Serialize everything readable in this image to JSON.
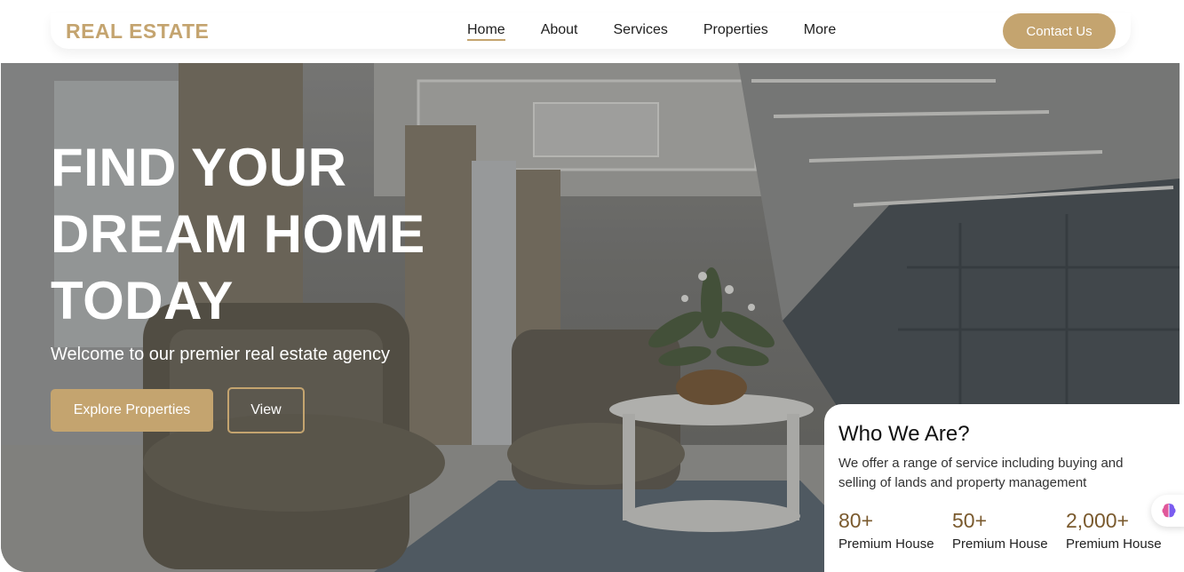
{
  "brand": {
    "logo": "REAL ESTATE",
    "accent_color": "#c4a46f"
  },
  "nav": {
    "links": [
      "Home",
      "About",
      "Services",
      "Properties",
      "More"
    ],
    "active": "Home",
    "contact_label": "Contact Us"
  },
  "hero": {
    "title_lines": [
      "FIND YOUR",
      "DREAM HOME",
      "TODAY"
    ],
    "subtitle": "Welcome to our premier real estate agency",
    "primary_button": "Explore Properties",
    "secondary_button": "View"
  },
  "about_card": {
    "title": "Who We Are?",
    "text": "We offer a range of service including buying and selling of lands and property management",
    "stats": [
      {
        "value": "80+",
        "label": "Premium House"
      },
      {
        "value": "50+",
        "label": "Premium House"
      },
      {
        "value": "2,000+",
        "label": "Premium House"
      }
    ]
  },
  "icons": {
    "assistant": "brain-icon"
  }
}
